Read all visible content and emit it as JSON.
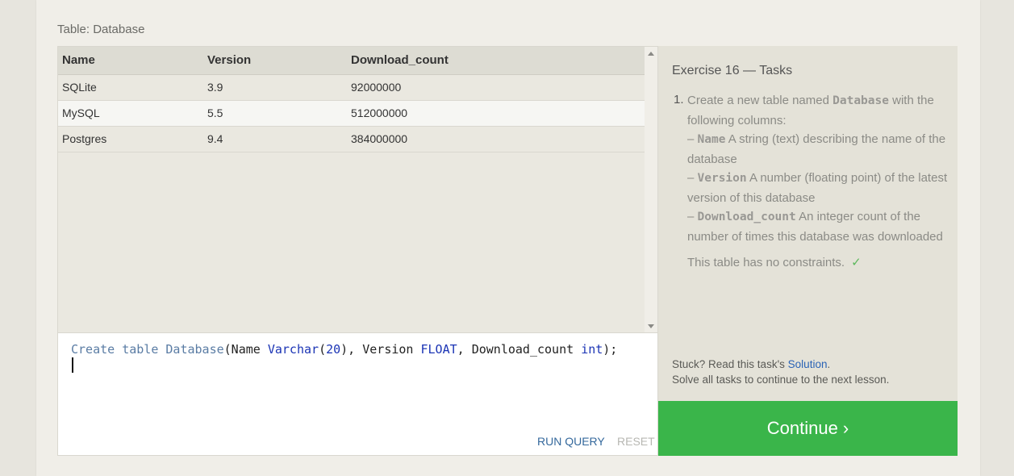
{
  "table_title": "Table: Database",
  "results": {
    "columns": [
      "Name",
      "Version",
      "Download_count"
    ],
    "rows": [
      [
        "SQLite",
        "3.9",
        "92000000"
      ],
      [
        "MySQL",
        "5.5",
        "512000000"
      ],
      [
        "Postgres",
        "9.4",
        "384000000"
      ]
    ]
  },
  "editor": {
    "tokens": [
      "Create table Database",
      "(Name ",
      "Varchar",
      "(",
      "20",
      "), Version ",
      "FLOAT",
      ", Download_count ",
      "int",
      ");"
    ],
    "run_label": "RUN QUERY",
    "reset_label": "RESET"
  },
  "tasks": {
    "title": "Exercise 16 — Tasks",
    "number": "1.",
    "intro_a": "Create a new table named",
    "intro_table": "Database",
    "intro_b": "with the following columns:",
    "columns": [
      {
        "dash": "–",
        "name": "Name",
        "desc": "A string (text) describing the name of the database"
      },
      {
        "dash": "–",
        "name": "Version",
        "desc": "A number (floating point) of the latest version of this database"
      },
      {
        "dash": "–",
        "name": "Download_count",
        "desc": "An integer count of the number of times this database was downloaded"
      }
    ],
    "constraint_text": "This table has no constraints.",
    "check": "✓",
    "stuck_a": "Stuck? Read this task's",
    "solution_link": "Solution",
    "stuck_b": ".",
    "solve_all": "Solve all tasks to continue to the next lesson."
  },
  "continue_label": "Continue ›",
  "colors": {
    "continue_bg": "#3ab54a",
    "link": "#2a63b5",
    "keyword": "#5a7ca4",
    "type": "#1b34b5"
  }
}
